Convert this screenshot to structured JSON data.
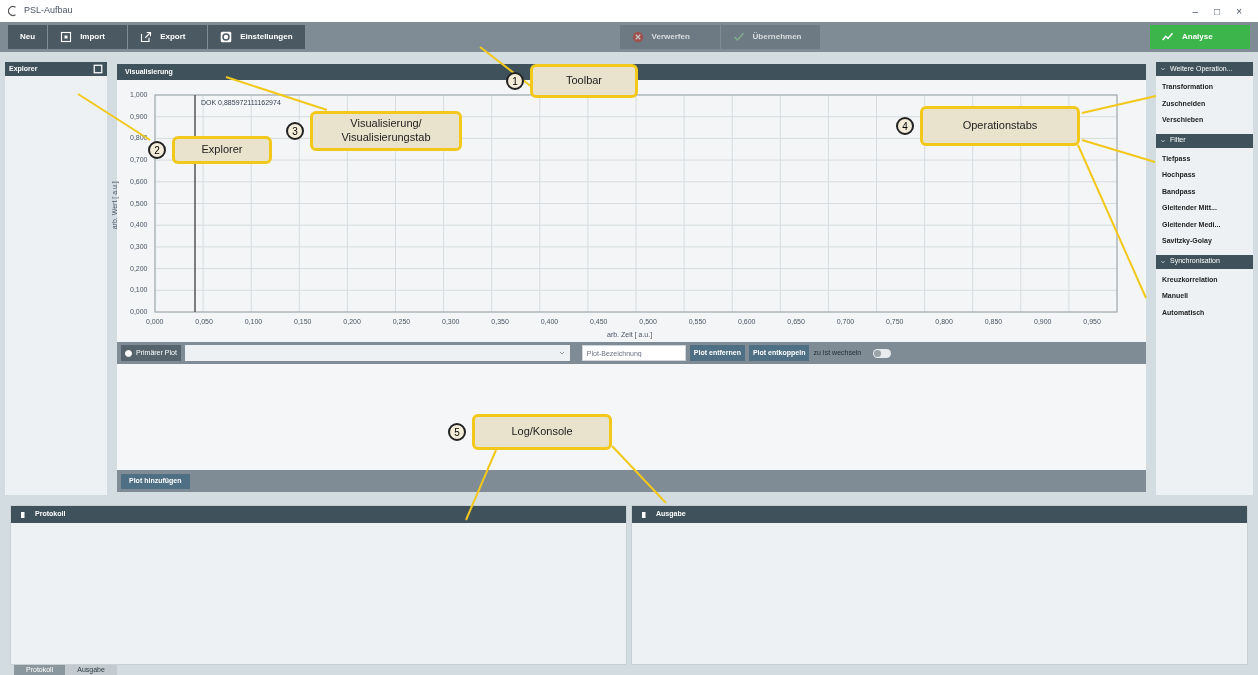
{
  "window": {
    "title": "PSL-Aufbau",
    "controls": [
      "–",
      "□",
      "×"
    ]
  },
  "toolbar": {
    "left": [
      {
        "label": "Neu"
      },
      {
        "label": "Import"
      },
      {
        "label": "Export"
      },
      {
        "label": "Einstellungen"
      }
    ],
    "center": [
      {
        "label": "Verwerfen",
        "disabled": true
      },
      {
        "label": "Übernehmen",
        "disabled": true
      }
    ],
    "right": {
      "label": "Analyse"
    }
  },
  "explorer": {
    "title": "Explorer"
  },
  "visualization": {
    "title": "Visualisierung",
    "cursor_label": "DOK 0,885972111162974",
    "ylabel": "arb. Wert [ a.u.]",
    "xlabel": "arb. Zeit [ a.u.]",
    "yticks": [
      "1,000",
      "0,900",
      "0,800",
      "0,700",
      "0,600",
      "0,500",
      "0,400",
      "0,300",
      "0,200",
      "0,100",
      "0,000"
    ],
    "xticks": [
      "0,000",
      "0,050",
      "0,100",
      "0,150",
      "0,200",
      "0,250",
      "0,300",
      "0,350",
      "0,400",
      "0,450",
      "0,500",
      "0,550",
      "0,600",
      "0,650",
      "0,700",
      "0,750",
      "0,800",
      "0,850",
      "0,900",
      "0,950"
    ],
    "plot_bar": {
      "radio_label": "Primärer Plot",
      "radio_checked": true,
      "name_placeholder": "Plot-Bezeichnung",
      "buttons": [
        "Plot entfernen",
        "Plot entkoppeln"
      ],
      "toggle_label": "zu Ist wechseln",
      "toggle_on": false
    },
    "add_button": "Plot hinzufügen"
  },
  "operations": [
    {
      "title": "Weitere Operation...",
      "items": [
        "Transformation",
        "Zuschneiden",
        "Verschieben"
      ]
    },
    {
      "title": "Filter",
      "items": [
        "Tiefpass",
        "Hochpass",
        "Bandpass",
        "Gleitender Mitt...",
        "Gleitender Medi...",
        "Savitzky-Golay"
      ]
    },
    {
      "title": "Synchronisation",
      "items": [
        "Kreuzkorrelation",
        "Manuell",
        "Automatisch"
      ]
    }
  ],
  "bottom_panels": [
    {
      "title": "Protokoll"
    },
    {
      "title": "Ausgabe"
    }
  ],
  "bottom_tabs": [
    {
      "label": "Protokoll",
      "selected": true
    },
    {
      "label": "Ausgabe",
      "selected": false
    }
  ],
  "callouts": [
    {
      "number": "1",
      "label": "Toolbar"
    },
    {
      "number": "2",
      "label": "Explorer"
    },
    {
      "number": "3",
      "label": "Visualisierung/ Visualisierungstab"
    },
    {
      "number": "4",
      "label": "Operationstabs"
    },
    {
      "number": "5",
      "label": "Log/Konsole"
    }
  ]
}
